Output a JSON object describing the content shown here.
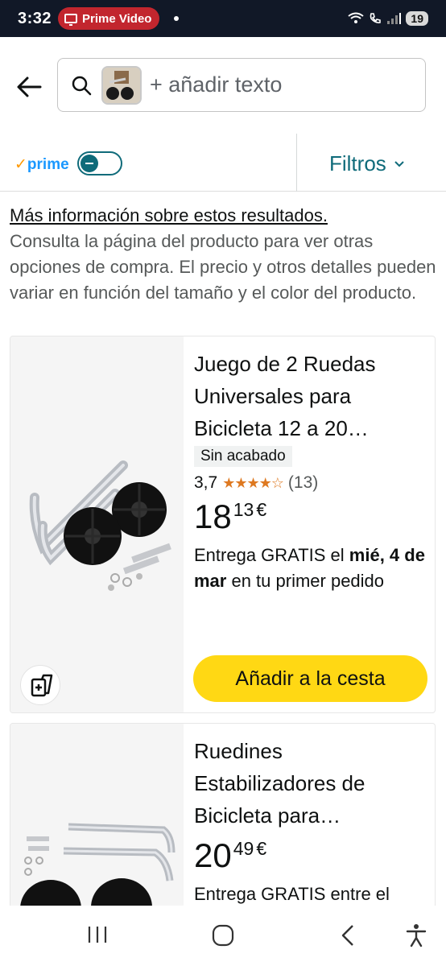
{
  "status_bar": {
    "time": "3:32",
    "app_pill": "Prime Video",
    "battery": "19"
  },
  "search": {
    "placeholder": "+ añadir texto"
  },
  "filter_bar": {
    "prime_label": "prime",
    "filters_label": "Filtros"
  },
  "info": {
    "link": "Más información sobre estos resultados.",
    "text": "Consulta la página del producto para ver otras opciones de compra. El precio y otros detalles pueden variar en función del tamaño y el color del producto."
  },
  "products": [
    {
      "title": "Juego de 2 Ruedas Universales para Bicicleta 12 a 20…",
      "badge": "Sin acabado",
      "rating": "3,7",
      "stars": "★★★★☆",
      "reviews": "(13)",
      "price_whole": "18",
      "price_fraction": "13",
      "currency": "€",
      "delivery_prefix": "Entrega GRATIS el ",
      "delivery_date": "mié, 4 de mar",
      "delivery_suffix": " en tu primer pedido",
      "cart_label": "Añadir a la cesta"
    },
    {
      "title": "Ruedines Estabilizadores de Bicicleta para…",
      "price_whole": "20",
      "price_fraction": "49",
      "currency": "€",
      "delivery_prefix": "Entrega GRATIS entre el"
    }
  ],
  "colors": {
    "accent_teal": "#0f6b7a",
    "cart_yellow": "#ffd814",
    "star_orange": "#de7921",
    "prime_blue": "#1a98ff",
    "status_red": "#c2262e"
  },
  "icons": [
    "back-arrow-icon",
    "search-icon",
    "compare-icon",
    "recents-icon",
    "home-icon",
    "nav-back-icon",
    "accessibility-icon"
  ]
}
